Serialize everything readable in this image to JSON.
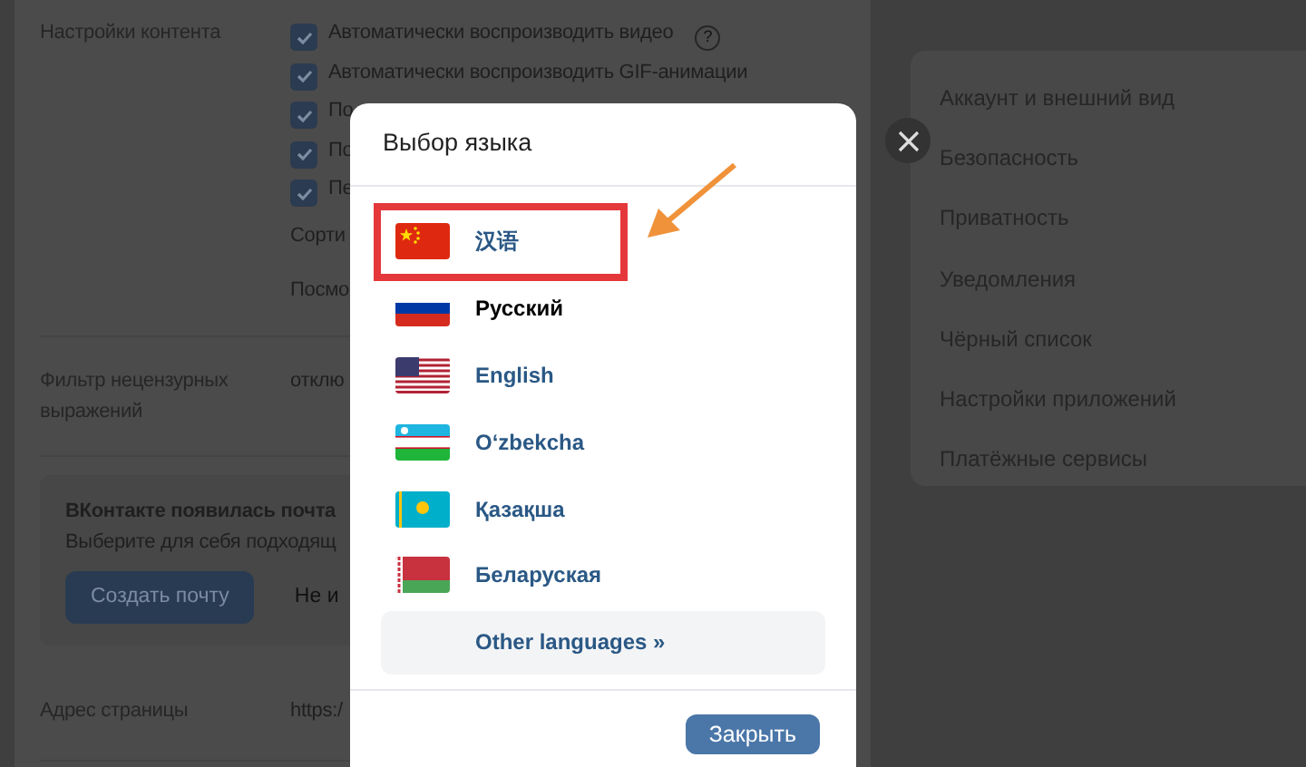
{
  "content_settings": {
    "label": "Настройки контента",
    "options": [
      {
        "label": "Автоматически воспроизводить видео",
        "checked": true,
        "help": "?"
      },
      {
        "label": "Автоматически воспроизводить GIF-анимации",
        "checked": true
      },
      {
        "label": "По",
        "checked": true
      },
      {
        "label": "По",
        "checked": true
      },
      {
        "label": "Пе",
        "checked": true
      }
    ],
    "lines": [
      "Сорти",
      "Посмо"
    ]
  },
  "filter": {
    "label": "Фильтр нецензурных выражений",
    "value": "отклю"
  },
  "mail_promo": {
    "title": "ВКонтакте появилась почта",
    "text": "Выберите для себя подходящ",
    "primary_button": "Создать почту",
    "secondary_button": "Не и"
  },
  "address": {
    "label": "Адрес страницы",
    "value": "https:/"
  },
  "menu": [
    "Аккаунт и внешний вид",
    "Безопасность",
    "Приватность",
    "Уведомления",
    "Чёрный список",
    "Настройки приложений",
    "Платёжные сервисы"
  ],
  "dialog": {
    "title": "Выбор языка",
    "languages": [
      {
        "label": "汉语",
        "selected": false,
        "highlighted": true
      },
      {
        "label": "Русский",
        "selected": true,
        "highlighted": false
      },
      {
        "label": "English",
        "selected": false,
        "highlighted": false
      },
      {
        "label": "O‘zbekcha",
        "selected": false,
        "highlighted": false
      },
      {
        "label": "Қазақша",
        "selected": false,
        "highlighted": false
      },
      {
        "label": "Беларуская",
        "selected": false,
        "highlighted": false
      }
    ],
    "more": "Other languages »",
    "close_button": "Закрыть"
  }
}
